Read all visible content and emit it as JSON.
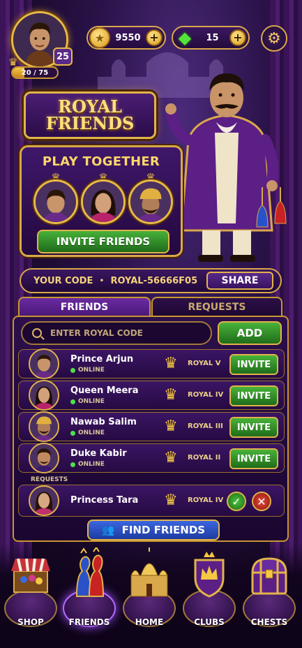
{
  "profile": {
    "level": "25",
    "xp_text": "20 / 75",
    "xp_fraction": 0.27
  },
  "currencies": {
    "coins": "9550",
    "gems": "15",
    "plus_label": "+"
  },
  "header": {
    "title_line1": "ROYAL",
    "title_line2": "FRIENDS"
  },
  "play_together": {
    "title": "PLAY TOGETHER",
    "invite_label": "INVITE FRIENDS"
  },
  "code_bar": {
    "label": "YOUR CODE",
    "separator": "•",
    "code": "ROYAL-56666F05",
    "share_label": "SHARE"
  },
  "tabs": [
    {
      "label": "FRIENDS",
      "active": true
    },
    {
      "label": "REQUESTS",
      "active": false
    }
  ],
  "search": {
    "placeholder": "ENTER ROYAL CODE",
    "value": "",
    "add_label": "ADD"
  },
  "friends": [
    {
      "name": "Prince Arjun",
      "status": "ONLINE",
      "rank": "ROYAL V",
      "action": "INVITE"
    },
    {
      "name": "Queen Meera",
      "status": "ONLINE",
      "rank": "ROYAL IV",
      "action": "INVITE"
    },
    {
      "name": "Nawab Salim",
      "status": "ONLINE",
      "rank": "ROYAL III",
      "action": "INVITE"
    },
    {
      "name": "Duke Kabir",
      "status": "ONLINE",
      "rank": "ROYAL II",
      "action": "INVITE"
    }
  ],
  "requests": {
    "label": "REQUESTS",
    "items": [
      {
        "name": "Princess Tara",
        "rank": "ROYAL IV"
      }
    ]
  },
  "find_friends_label": "FIND FRIENDS",
  "nav": [
    {
      "label": "SHOP"
    },
    {
      "label": "FRIENDS",
      "active": true
    },
    {
      "label": "HOME"
    },
    {
      "label": "CLUBS"
    },
    {
      "label": "CHESTS"
    }
  ],
  "icons": {
    "coin": "coin-icon",
    "gem": "gem-icon",
    "settings": "gear-icon",
    "crown": "crown-icon",
    "search": "search-icon",
    "people": "people-icon",
    "accept": "check-icon",
    "decline": "close-icon"
  },
  "colors": {
    "gold": "#e2b34b",
    "green_button": "#2f8e26",
    "blue_button": "#2a4ec0",
    "purple_bg": "#2a0c48",
    "online": "#4ee04a"
  }
}
